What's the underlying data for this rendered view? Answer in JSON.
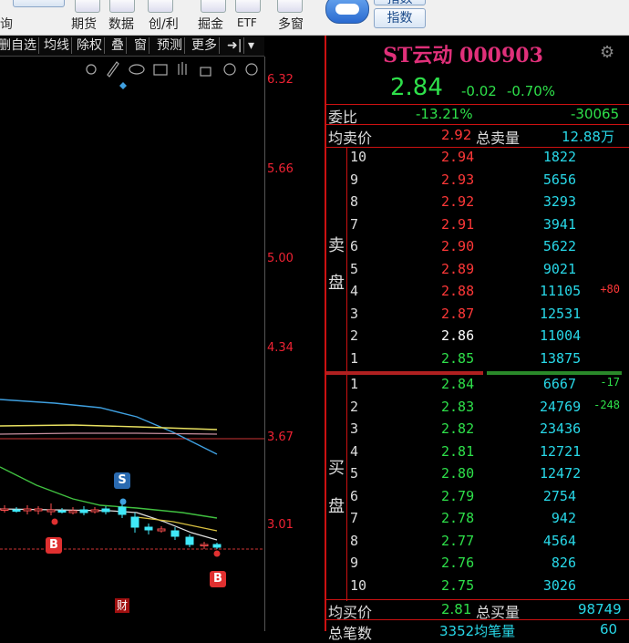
{
  "toolbar": {
    "items": [
      {
        "label": "期货",
        "icon": "futures-icon"
      },
      {
        "label": "数据",
        "icon": "data-icon"
      },
      {
        "label": "创/利",
        "icon": "growth-icon"
      },
      {
        "label": "掘金",
        "icon": "gold-icon"
      },
      {
        "label": "ETF",
        "icon": "etf-icon"
      },
      {
        "label": "多窗",
        "icon": "multiwindow-icon"
      }
    ],
    "left_label": "询",
    "right_button": "指数",
    "top_right_partial": "指数"
  },
  "tabs": [
    "删自选",
    "均线",
    "除权",
    "叠",
    "窗",
    "预测",
    "更多",
    "➜|",
    "▾"
  ],
  "chart_tools": [
    "settings-icon",
    "pen-icon",
    "eye-icon",
    "bag-icon",
    "hand-icon",
    "lock-icon",
    "zoom-in-icon",
    "zoom-out-icon"
  ],
  "price_axis": [
    "6.32",
    "5.66",
    "5.00",
    "4.34",
    "3.67",
    "3.01"
  ],
  "markers": {
    "s": "S",
    "b": "B",
    "fin": "财"
  },
  "chart_data": {
    "type": "candlestick",
    "series": [
      {
        "name": "MA-yellow",
        "color": "#e8e060",
        "values": [
          3.76,
          3.76,
          3.76,
          3.75,
          3.75,
          3.74
        ]
      },
      {
        "name": "MA-blue",
        "color": "#3fa0e0",
        "values": [
          4.05,
          4.0,
          3.95,
          3.9,
          3.8,
          3.64
        ]
      },
      {
        "name": "MA-green",
        "color": "#40c040",
        "values": [
          3.9,
          3.55,
          3.3,
          3.1,
          3.05,
          3.0
        ]
      },
      {
        "name": "MA-white",
        "color": "#e0e0e0",
        "values": [
          3.12,
          3.12,
          3.12,
          3.1,
          3.0,
          2.9
        ]
      }
    ],
    "ylim": [
      2.5,
      6.5
    ]
  },
  "quote": {
    "title": "ST云动 000903",
    "price": "2.84",
    "change": "-0.02",
    "pct": "-0.70%",
    "weibi_label": "委比",
    "weibi_pct": "-13.21%",
    "weibi_diff": "-30065",
    "avg_sell_label": "均卖价",
    "avg_sell": "2.92",
    "total_sell_label": "总卖量",
    "total_sell": "12.88万",
    "sell_side_label": [
      "卖",
      "盘"
    ],
    "buy_side_label": [
      "买",
      "盘"
    ],
    "sell": [
      {
        "lvl": "10",
        "price": "2.94",
        "vol": "1822",
        "d": ""
      },
      {
        "lvl": "9",
        "price": "2.93",
        "vol": "5656",
        "d": ""
      },
      {
        "lvl": "8",
        "price": "2.92",
        "vol": "3293",
        "d": ""
      },
      {
        "lvl": "7",
        "price": "2.91",
        "vol": "3941",
        "d": ""
      },
      {
        "lvl": "6",
        "price": "2.90",
        "vol": "5622",
        "d": ""
      },
      {
        "lvl": "5",
        "price": "2.89",
        "vol": "9021",
        "d": ""
      },
      {
        "lvl": "4",
        "price": "2.88",
        "vol": "11105",
        "d": "+80"
      },
      {
        "lvl": "3",
        "price": "2.87",
        "vol": "12531",
        "d": ""
      },
      {
        "lvl": "2",
        "price": "2.86",
        "vol": "11004",
        "d": ""
      },
      {
        "lvl": "1",
        "price": "2.85",
        "vol": "13875",
        "d": ""
      }
    ],
    "buy": [
      {
        "lvl": "1",
        "price": "2.84",
        "vol": "6667",
        "d": "-17"
      },
      {
        "lvl": "2",
        "price": "2.83",
        "vol": "24769",
        "d": "-248"
      },
      {
        "lvl": "3",
        "price": "2.82",
        "vol": "23436",
        "d": ""
      },
      {
        "lvl": "4",
        "price": "2.81",
        "vol": "12721",
        "d": ""
      },
      {
        "lvl": "5",
        "price": "2.80",
        "vol": "12472",
        "d": ""
      },
      {
        "lvl": "6",
        "price": "2.79",
        "vol": "2754",
        "d": ""
      },
      {
        "lvl": "7",
        "price": "2.78",
        "vol": "942",
        "d": ""
      },
      {
        "lvl": "8",
        "price": "2.77",
        "vol": "4564",
        "d": ""
      },
      {
        "lvl": "9",
        "price": "2.76",
        "vol": "826",
        "d": ""
      },
      {
        "lvl": "10",
        "price": "2.75",
        "vol": "3026",
        "d": ""
      }
    ],
    "avg_buy_label": "均买价",
    "avg_buy": "2.81",
    "total_buy_label": "总买量",
    "total_buy": "98749",
    "bottom_left": "总笔数",
    "bottom_mid": "3352均笔量",
    "bottom_right": "60"
  },
  "colors": {
    "up": "#ff3838",
    "down": "#2ee04a",
    "vol": "#28d8e8",
    "title": "#e0307a"
  }
}
